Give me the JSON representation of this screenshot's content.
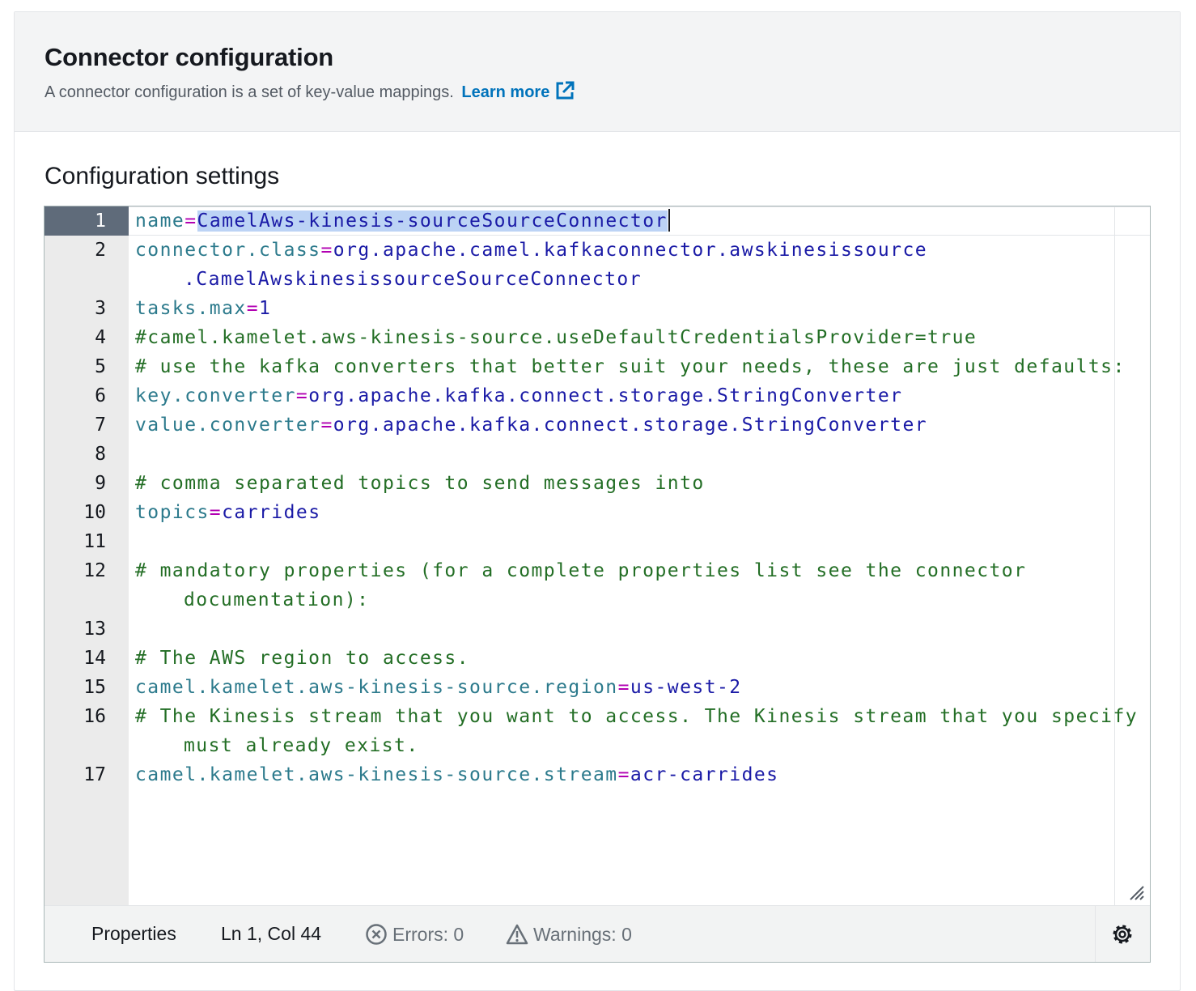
{
  "panel": {
    "title": "Connector configuration",
    "description": "A connector configuration is a set of key-value mappings.",
    "learn_more": "Learn more"
  },
  "section_title": "Configuration settings",
  "editor": {
    "line_numbers": [
      "1",
      "2",
      "3",
      "4",
      "5",
      "6",
      "7",
      "8",
      "9",
      "10",
      "11",
      "12",
      "13",
      "14",
      "15",
      "16",
      "17"
    ],
    "lines": {
      "l1_key": "name",
      "l1_val": "CamelAws-kinesis-sourceSourceConnector",
      "l2_key": "connector.class",
      "l2_val": "org.apache.camel.kafkaconnector.awskinesissource",
      "l2_cont": ".CamelAwskinesissourceSourceConnector",
      "l3_key": "tasks.max",
      "l3_val": "1",
      "l4": "#camel.kamelet.aws-kinesis-source.useDefaultCredentialsProvider=true",
      "l5": "# use the kafka converters that better suit your needs, these are just defaults:",
      "l6_key": "key.converter",
      "l6_val": "org.apache.kafka.connect.storage.StringConverter",
      "l7_key": "value.converter",
      "l7_val": "org.apache.kafka.connect.storage.StringConverter",
      "l9": "# comma separated topics to send messages into",
      "l10_key": "topics",
      "l10_val": "carrides",
      "l12": "# mandatory properties (for a complete properties list see the connector",
      "l12_cont": "documentation):",
      "l14": "# The AWS region to access.",
      "l15_key": "camel.kamelet.aws-kinesis-source.region",
      "l15_val": "us-west-2",
      "l16": "# The Kinesis stream that you want to access. The Kinesis stream that you specify",
      "l16_cont": "must already exist.",
      "l17_key": "camel.kamelet.aws-kinesis-source.stream",
      "l17_val": "acr-carrides",
      "equals": "="
    }
  },
  "status": {
    "language": "Properties",
    "position": "Ln 1, Col 44",
    "errors": "Errors: 0",
    "warnings": "Warnings: 0"
  },
  "colors": {
    "key": "#2c7a8c",
    "equals": "#b200b2",
    "value": "#1a1aa6",
    "comment": "#236e25",
    "link": "#0073bb",
    "selection": "#bcd3f5"
  },
  "icons": {
    "learn_more": "external-link-icon",
    "errors": "error-circle-icon",
    "warnings": "warning-triangle-icon",
    "settings": "gear-icon",
    "resize": "resize-handle-icon"
  }
}
